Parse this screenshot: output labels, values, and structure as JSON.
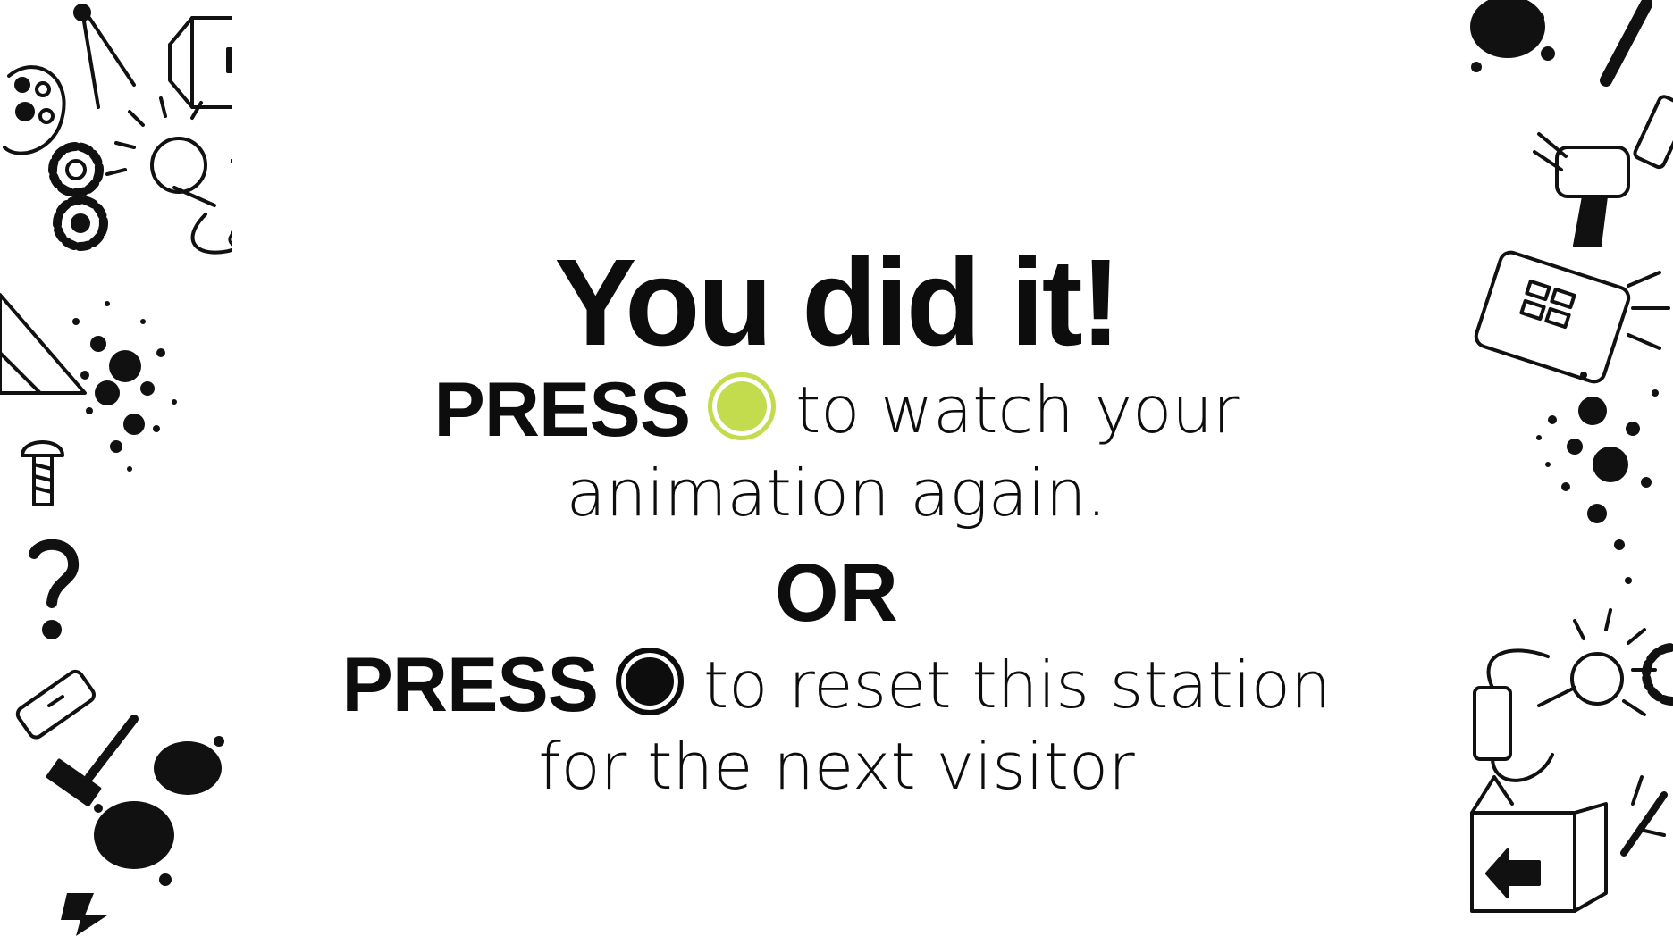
{
  "screen": {
    "title": "You did it!",
    "option1": {
      "press_label": "PRESS",
      "button_color": "#c3dc4d",
      "line1": "to watch your",
      "line2": "animation again."
    },
    "separator": "OR",
    "option2": {
      "press_label": "PRESS",
      "button_color": "#0d0d0d",
      "line1": "to reset this station",
      "line2": "for the next visitor"
    }
  },
  "decorations": {
    "left_icons": [
      "compass-icon",
      "box-arrow-icon",
      "palette-icon",
      "gear-icon",
      "light-bulb-icon",
      "battery-icon",
      "ruler-triangle-icon",
      "ink-splatter-icon",
      "screw-icon",
      "question-mark-icon",
      "battery-icon",
      "hammer-icon",
      "ink-blot-icon",
      "lightning-icon"
    ],
    "right_icons": [
      "ink-blot-icon",
      "screwdriver-icon",
      "battery-icon",
      "ray-gun-icon",
      "tablet-icon",
      "ink-splatter-icon",
      "light-bulb-icon",
      "battery-icon",
      "gear-icon",
      "box-arrow-icon",
      "syringe-icon"
    ]
  }
}
